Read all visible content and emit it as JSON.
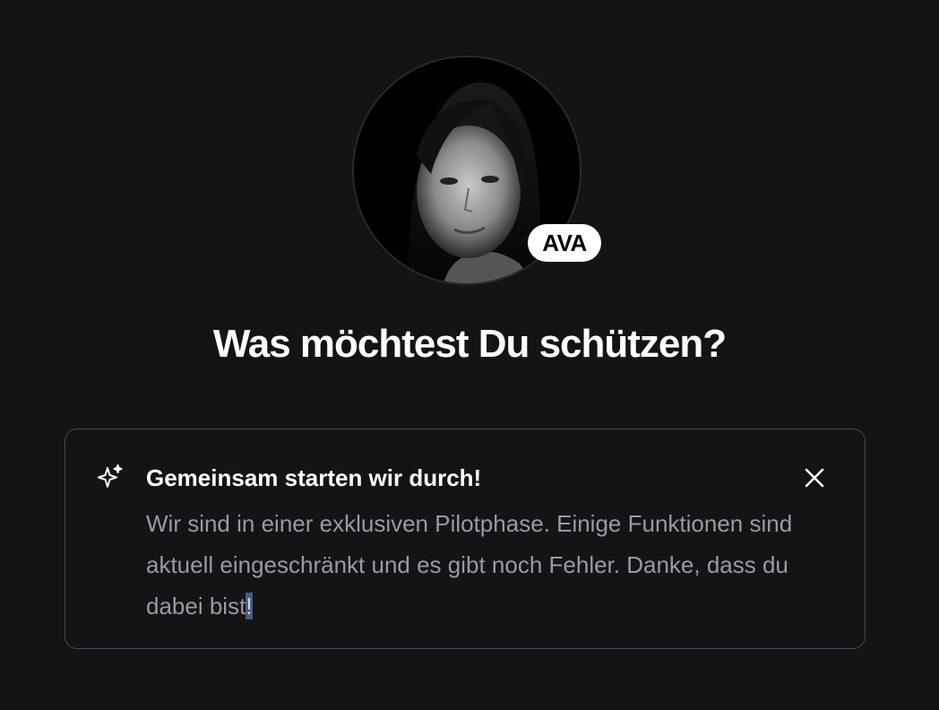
{
  "avatar": {
    "badge": "AVA"
  },
  "heading": "Was möchtest Du schützen?",
  "notice": {
    "icon": "sparkles-icon",
    "title": "Gemeinsam starten wir durch!",
    "body_main": "Wir sind in einer exklusiven Pilotphase. Einige Funktionen sind aktuell eingeschränkt und es gibt noch Fehler. Danke, dass du dabei bist",
    "body_end": "!",
    "close_icon": "close-icon"
  },
  "colors": {
    "background": "#141416",
    "text": "#ffffff",
    "muted_text": "#9a9a9f",
    "border": "#4a4a4e",
    "selection": "#4b5b80"
  }
}
